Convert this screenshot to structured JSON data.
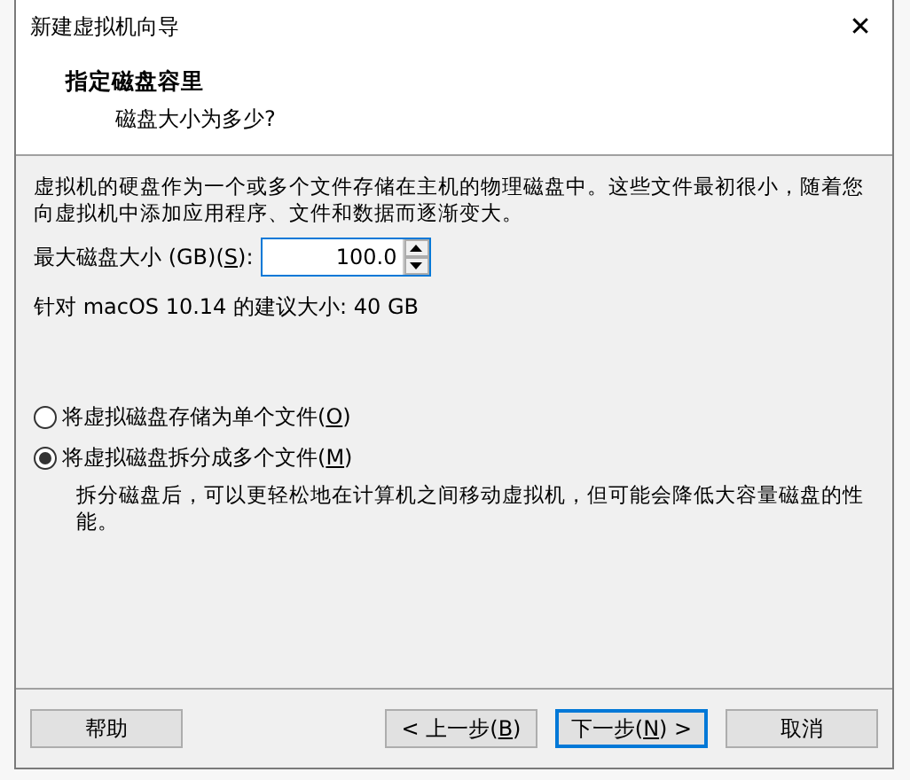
{
  "window": {
    "title": "新建虚拟机向导",
    "close": "✕"
  },
  "header": {
    "title": "指定磁盘容里",
    "subtitle": "磁盘大小为多少?"
  },
  "description": "虚拟机的硬盘作为一个或多个文件存储在主机的物理磁盘中。这些文件最初很小，随着您向虚拟机中添加应用程序、文件和数据而逐渐变大。",
  "disk_size": {
    "label": "最大磁盘大小 (GB)(",
    "access_key": "S",
    "label_end": "):",
    "value": "100.0"
  },
  "recommendation": "针对 macOS 10.14 的建议大小: 40 GB",
  "options": [
    {
      "label": "将虚拟磁盘存储为单个文件(",
      "access_key": "O",
      "label_end": ")",
      "selected": false
    },
    {
      "label": "将虚拟磁盘拆分成多个文件(",
      "access_key": "M",
      "label_end": ")",
      "selected": true,
      "note": "拆分磁盘后，可以更轻松地在计算机之间移动虚拟机，但可能会降低大容量磁盘的性能。"
    }
  ],
  "buttons": [
    {
      "label": "帮助",
      "kind": "help",
      "focused": false
    },
    {
      "label": "< 上一步(",
      "access_key": "B",
      "label_end": ")",
      "kind": "nav",
      "focused": false
    },
    {
      "label": "下一步(",
      "access_key": "N",
      "label_end": ") >",
      "kind": "nav",
      "focused": true
    },
    {
      "label": "取消",
      "kind": "nav",
      "focused": false
    }
  ]
}
